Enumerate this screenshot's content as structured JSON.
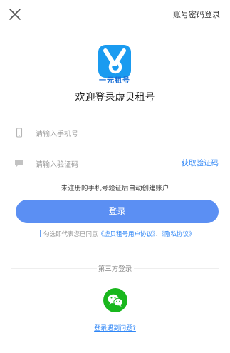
{
  "header": {
    "close_icon": "close-icon",
    "password_login_label": "账号密码登录"
  },
  "brand": {
    "logo_icon": "app-logo-icon",
    "logo_tag": "一元租号",
    "welcome": "欢迎登录虚贝租号",
    "color": "#1a9bf0"
  },
  "form": {
    "phone": {
      "icon": "phone-icon",
      "placeholder": "请输入手机号"
    },
    "code": {
      "icon": "message-icon",
      "placeholder": "请输入验证码",
      "get_code_label": "获取验证码"
    },
    "hint": "未注册的手机号验证后自动创建账户",
    "login_label": "登录",
    "login_color": "#5b8ff3"
  },
  "agreement": {
    "prefix": "勾选即代表您已同意",
    "user_agreement": "《虚贝租号用户协议》",
    "separator": "、",
    "privacy": "《隐私协议》"
  },
  "third_party": {
    "title": "第三方登录",
    "wechat_icon": "wechat-icon",
    "wechat_color": "#19b71d",
    "trouble_label": "登录遇到问题?"
  }
}
